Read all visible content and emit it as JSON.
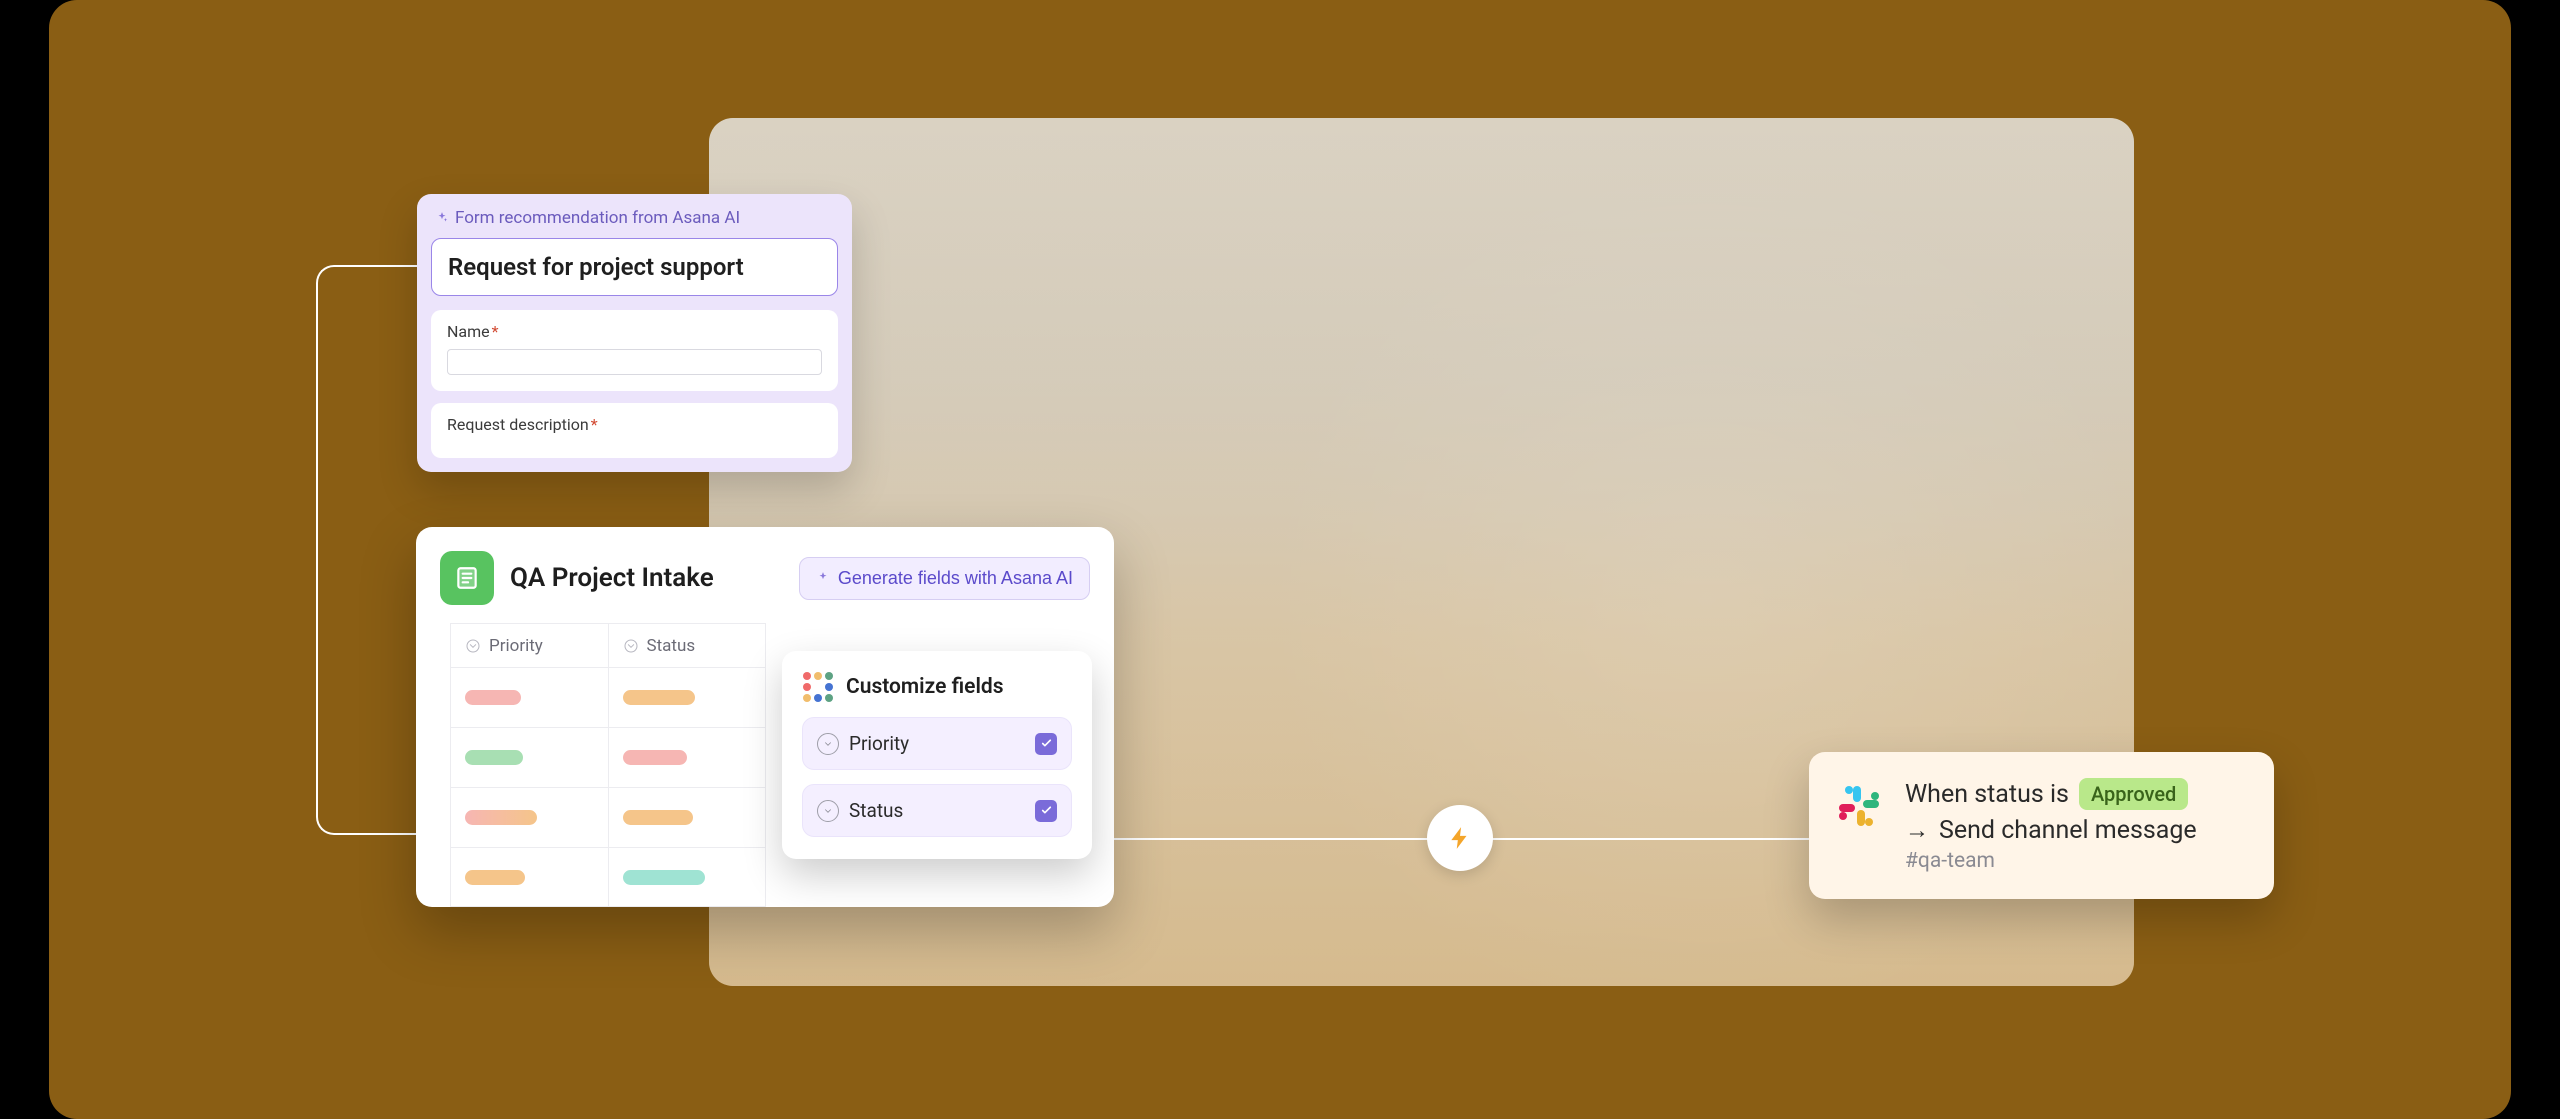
{
  "form_card": {
    "hint": "Form recommendation from Asana AI",
    "title": "Request for project support",
    "name_label": "Name",
    "request_label": "Request description",
    "required_mark": "*"
  },
  "intake": {
    "title": "QA Project Intake",
    "generate_label": "Generate fields with Asana AI",
    "columns": {
      "priority": "Priority",
      "status": "Status"
    }
  },
  "customize": {
    "title": "Customize fields",
    "fields": [
      {
        "label": "Priority",
        "checked": true
      },
      {
        "label": "Status",
        "checked": true
      }
    ]
  },
  "automation": {
    "when_text": "When status is",
    "status_value": "Approved",
    "action_text": "Send channel message",
    "channel": "#qa-team"
  },
  "colors": {
    "stage": "#8a5e14",
    "accent_purple": "#7a6bd9",
    "mint": "#58c360"
  }
}
